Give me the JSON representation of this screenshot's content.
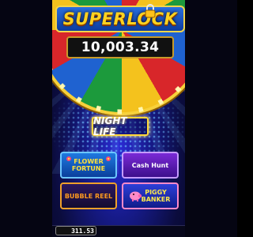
{
  "header": {
    "title": "SUPERLOCK",
    "jackpot_value": "10,003.34"
  },
  "lobby": {
    "featured_logo": "NIGHT LIFE",
    "games": [
      {
        "label": "FLOWER FORTUNE"
      },
      {
        "label": "Cash Hunt"
      },
      {
        "label": "BUBBLE REEL"
      },
      {
        "label": "PIGGY BANKER"
      }
    ]
  },
  "footer": {
    "balance": "311.53"
  },
  "colors": {
    "accent_gold": "#ffd21f",
    "background_blue": "#161a88"
  }
}
